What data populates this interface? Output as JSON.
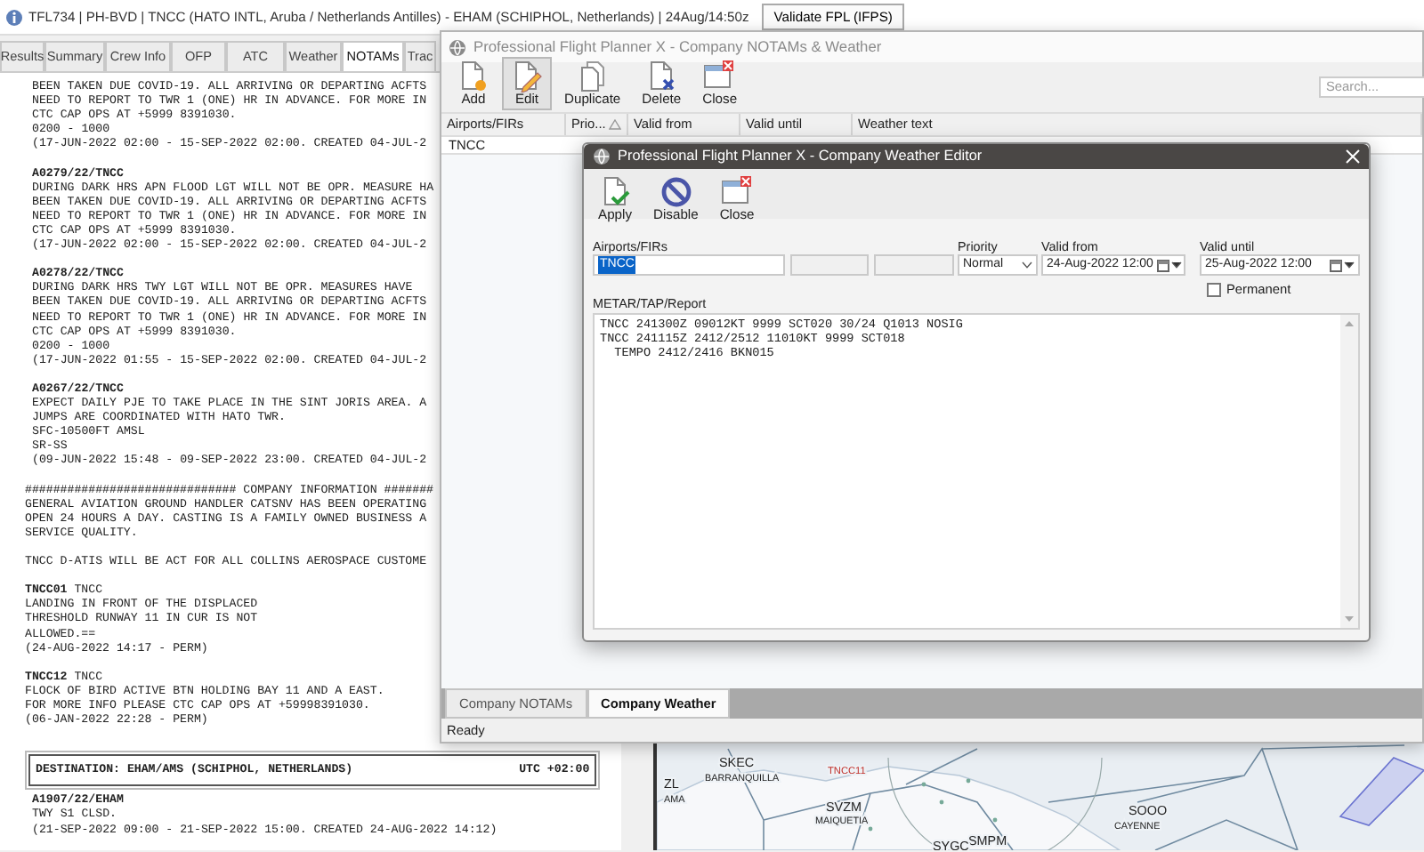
{
  "title_bar": {
    "text": "TFL734 | PH-BVD | TNCC (HATO INTL, Aruba / Netherlands Antilles) - EHAM (SCHIPHOL, Netherlands) | 24Aug/14:50z",
    "button": "Validate FPL (IFPS)"
  },
  "tabs": [
    {
      "label": "Results",
      "selected": false
    },
    {
      "label": "Summary",
      "selected": false
    },
    {
      "label": "Crew Info",
      "selected": false
    },
    {
      "label": "OFP",
      "selected": false
    },
    {
      "label": "ATC",
      "selected": false
    },
    {
      "label": "Weather",
      "selected": false
    },
    {
      "label": "NOTAMs",
      "selected": true
    },
    {
      "label": "Trac",
      "selected": false
    }
  ],
  "notam_text": {
    "origin_blocks": [
      {
        "lines": [
          "BEEN TAKEN DUE COVID-19. ALL ARRIVING OR DEPARTING ACFTS",
          "NEED TO REPORT TO TWR 1 (ONE) HR IN ADVANCE. FOR MORE IN",
          "CTC CAP OPS AT +5999 8391030.",
          "0200 - 1000",
          "(17-JUN-2022 02:00 - 15-SEP-2022 02:00. CREATED 04-JUL-2"
        ]
      },
      {
        "title": "A0279/22/TNCC",
        "lines": [
          "DURING DARK HRS APN FLOOD LGT WILL NOT BE OPR. MEASURE HA",
          "BEEN TAKEN DUE COVID-19. ALL ARRIVING OR DEPARTING ACFTS",
          "NEED TO REPORT TO TWR 1 (ONE) HR IN ADVANCE. FOR MORE IN",
          "CTC CAP OPS AT +5999 8391030.",
          "(17-JUN-2022 02:00 - 15-SEP-2022 02:00. CREATED 04-JUL-2"
        ]
      },
      {
        "title": "A0278/22/TNCC",
        "lines": [
          "DURING DARK HRS TWY LGT WILL NOT BE OPR. MEASURES HAVE",
          "BEEN TAKEN DUE COVID-19. ALL ARRIVING OR DEPARTING ACFTS",
          "NEED TO REPORT TO TWR 1 (ONE) HR IN ADVANCE. FOR MORE IN",
          "CTC CAP OPS AT +5999 8391030.",
          "0200 - 1000",
          "(17-JUN-2022 01:55 - 15-SEP-2022 02:00. CREATED 04-JUL-2"
        ]
      },
      {
        "title": "A0267/22/TNCC",
        "lines": [
          "EXPECT DAILY PJE TO TAKE PLACE IN THE SINT JORIS AREA. A",
          "JUMPS ARE COORDINATED WITH HATO TWR.",
          "SFC-10500FT AMSL",
          "SR-SS",
          "(09-JUN-2022 15:48 - 09-SEP-2022 23:00. CREATED 04-JUL-2"
        ]
      }
    ],
    "company_information": {
      "header": "############################## COMPANY INFORMATION #######",
      "blocks": [
        {
          "lines": [
            "GENERAL AVIATION GROUND HANDLER CATSNV HAS BEEN OPERATING",
            "OPEN 24 HOURS A DAY. CASTING IS A FAMILY OWNED BUSINESS A",
            "SERVICE QUALITY."
          ]
        },
        {
          "lines": [
            "TNCC D-ATIS WILL BE ACT FOR ALL COLLINS AEROSPACE CUSTOME"
          ]
        },
        {
          "lines": [
            "**TNCC01** TNCC",
            "LANDING IN FRONT OF THE DISPLACED",
            "THRESHOLD RUNWAY 11 IN CUR IS NOT",
            "ALLOWED.==",
            "(24-AUG-2022 14:17 - PERM)"
          ]
        },
        {
          "lines": [
            "**TNCC12** TNCC",
            "FLOCK OF BIRD ACTIVE BTN HOLDING BAY 11 AND A EAST.",
            "FOR MORE INFO PLEASE CTC CAP OPS AT +59998391030.",
            "(06-JAN-2022 22:28 - PERM)"
          ]
        }
      ]
    },
    "destination": {
      "title": "DESTINATION: EHAM/AMS (SCHIPHOL, NETHERLANDS)",
      "utc": "UTC +02:00",
      "blocks": [
        {
          "title": "A1907/22/EHAM",
          "lines": [
            "TWY S1 CLSD.",
            "(21-SEP-2022 09:00 - 21-SEP-2022 15:00. CREATED 24-AUG-2022 14:12)"
          ]
        }
      ]
    }
  },
  "map": {
    "labels": [
      {
        "text": "SKEC",
        "kind": "code"
      },
      {
        "text": "BARRANQUILLA",
        "kind": "name"
      },
      {
        "text": "ZL",
        "kind": "code"
      },
      {
        "text": "AMA",
        "kind": "name"
      },
      {
        "text": "TNCC11",
        "kind": "alert"
      },
      {
        "text": "SVZM",
        "kind": "code"
      },
      {
        "text": "MAIQUETIA",
        "kind": "name"
      },
      {
        "text": "SOOO",
        "kind": "code"
      },
      {
        "text": "CAYENNE",
        "kind": "name"
      },
      {
        "text": "SMPM",
        "kind": "code"
      },
      {
        "text": "SYGC",
        "kind": "code"
      }
    ]
  },
  "notams_window": {
    "title": "Professional Flight Planner X - Company NOTAMs & Weather",
    "toolbar": [
      {
        "kind": "add",
        "label": "Add",
        "pressed": false
      },
      {
        "kind": "edit",
        "label": "Edit",
        "pressed": true
      },
      {
        "kind": "duplicate",
        "label": "Duplicate",
        "pressed": false
      },
      {
        "kind": "delete",
        "label": "Delete",
        "pressed": false
      },
      {
        "kind": "close",
        "label": "Close",
        "pressed": false
      }
    ],
    "search": {
      "placeholder": "Search..."
    },
    "columns": [
      {
        "label": "Airports/FIRs",
        "sorted": false
      },
      {
        "label": "Prio...",
        "sorted": true
      },
      {
        "label": "Valid from",
        "sorted": false
      },
      {
        "label": "Valid until",
        "sorted": false
      },
      {
        "label": "Weather text",
        "sorted": false
      }
    ],
    "rows": [
      {
        "airport": "TNCC"
      }
    ],
    "bottom_tabs": [
      {
        "label": "Company NOTAMs",
        "selected": false
      },
      {
        "label": "Company Weather",
        "selected": true
      }
    ],
    "status": "Ready"
  },
  "editor": {
    "title": "Professional Flight Planner X - Company Weather Editor",
    "toolbar": [
      {
        "kind": "apply",
        "label": "Apply"
      },
      {
        "kind": "disable",
        "label": "Disable"
      },
      {
        "kind": "close",
        "label": "Close"
      }
    ],
    "airports": {
      "label": "Airports/FIRs",
      "value": "TNCC",
      "highlighted": true
    },
    "priority": {
      "label": "Priority",
      "value": "Normal"
    },
    "valid_from": {
      "label": "Valid from",
      "value": "24-Aug-2022 12:00"
    },
    "valid_until": {
      "label": "Valid until",
      "value": "25-Aug-2022 12:00"
    },
    "permanent": {
      "label": "Permanent",
      "checked": false
    },
    "report": {
      "label": "METAR/TAP/Report",
      "lines": [
        "TNCC 241300Z 09012KT 9999 SCT020 30/24 Q1013 NOSIG",
        "TNCC 241115Z 2412/2512 11010KT 9999 SCT018",
        "  TEMPO 2412/2416 BKN015"
      ]
    }
  }
}
